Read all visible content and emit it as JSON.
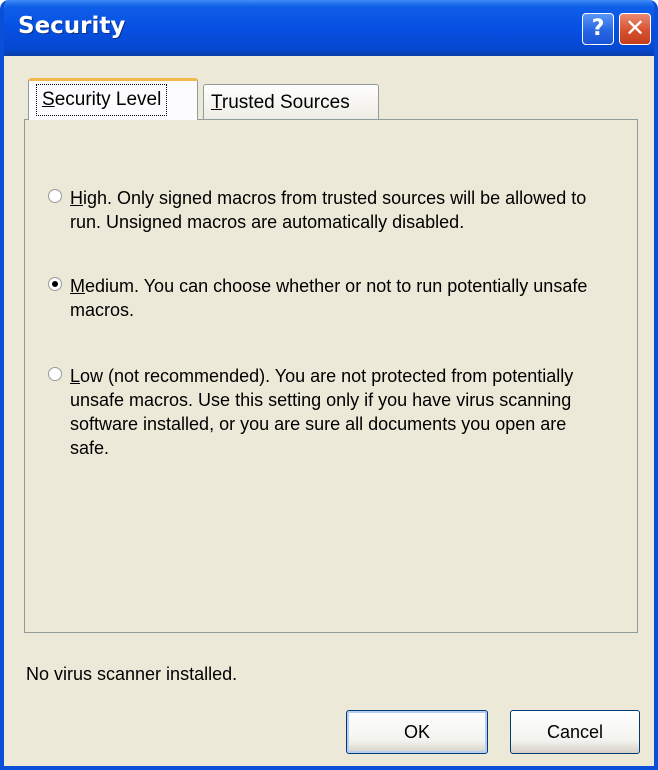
{
  "window": {
    "title": "Security",
    "help_glyph": "?",
    "close_glyph": "✕"
  },
  "tabs": [
    {
      "label_key": "S",
      "label_rest": "ecurity Level",
      "active": true
    },
    {
      "label_key": "T",
      "label_rest": "rusted Sources",
      "active": false
    }
  ],
  "options": [
    {
      "key": "H",
      "text": "igh. Only signed macros from trusted sources will be allowed to run. Unsigned macros are automatically disabled.",
      "checked": false
    },
    {
      "key": "M",
      "text": "edium. You can choose whether or not to run potentially unsafe macros.",
      "checked": true
    },
    {
      "key": "L",
      "text": "ow (not recommended). You are not protected from potentially unsafe macros. Use this setting only if you have virus scanning software installed, or you are sure all documents you open are safe.",
      "checked": false
    }
  ],
  "status": "No virus scanner installed.",
  "buttons": {
    "ok": "OK",
    "cancel": "Cancel"
  },
  "colors": {
    "title_bar": "#0650e3",
    "dialog_bg": "#ece9d8",
    "tab_highlight": "#f1b84a",
    "close_button": "#d8512f"
  }
}
